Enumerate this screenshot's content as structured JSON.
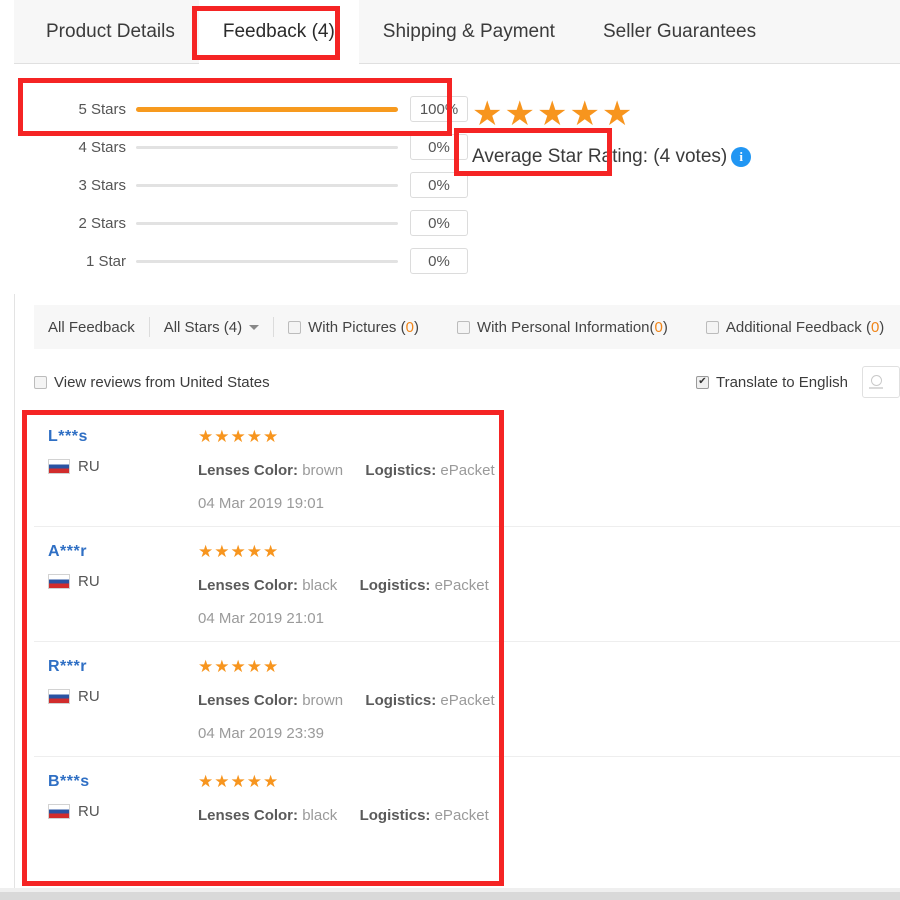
{
  "tabs": [
    {
      "label": "Product Details",
      "active": false
    },
    {
      "label": "Feedback (4)",
      "active": true
    },
    {
      "label": "Shipping & Payment",
      "active": false
    },
    {
      "label": "Seller Guarantees",
      "active": false
    }
  ],
  "rating_summary": {
    "rows": [
      {
        "label": "5 Stars",
        "percent_text": "100%",
        "percent_value": 100
      },
      {
        "label": "4 Stars",
        "percent_text": "0%",
        "percent_value": 0
      },
      {
        "label": "3 Stars",
        "percent_text": "0%",
        "percent_value": 0
      },
      {
        "label": "2 Stars",
        "percent_text": "0%",
        "percent_value": 0
      },
      {
        "label": "1 Star",
        "percent_text": "0%",
        "percent_value": 0
      }
    ],
    "average_stars": "★★★★★",
    "average_label": "Average Star Rating:  (4 votes)",
    "info_icon": "i",
    "bar_color": "#f79a1e",
    "star_color": "#f7951e"
  },
  "filters": {
    "all_feedback": "All Feedback",
    "all_stars": "All Stars (4)",
    "with_pictures_label": "With Pictures (",
    "with_pictures_count": "0",
    "with_pictures_tail": ")",
    "with_personal_label": "With Personal Information(",
    "with_personal_count": "0",
    "with_personal_tail": ")",
    "additional_label": "Additional Feedback (",
    "additional_count": "0",
    "additional_tail": ")"
  },
  "options": {
    "view_reviews_country": "View reviews from United States",
    "view_reviews_checked": false,
    "translate": "Translate to English",
    "translate_checked": true
  },
  "reviews": [
    {
      "name": "L***s",
      "country": "RU",
      "stars": "★★★★★",
      "attr1_key": "Lenses Color:",
      "attr1_val": "brown",
      "attr2_key": "Logistics:",
      "attr2_val": "ePacket",
      "date": "04 Mar 2019 19:01"
    },
    {
      "name": "A***r",
      "country": "RU",
      "stars": "★★★★★",
      "attr1_key": "Lenses Color:",
      "attr1_val": "black",
      "attr2_key": "Logistics:",
      "attr2_val": "ePacket",
      "date": "04 Mar 2019 21:01"
    },
    {
      "name": "R***r",
      "country": "RU",
      "stars": "★★★★★",
      "attr1_key": "Lenses Color:",
      "attr1_val": "brown",
      "attr2_key": "Logistics:",
      "attr2_val": "ePacket",
      "date": "04 Mar 2019 23:39"
    },
    {
      "name": "B***s",
      "country": "RU",
      "stars": "★★★★★",
      "attr1_key": "Lenses Color:",
      "attr1_val": "black",
      "attr2_key": "Logistics:",
      "attr2_val": "ePacket",
      "date": ""
    }
  ],
  "annotations": {
    "color": "#f52424"
  }
}
